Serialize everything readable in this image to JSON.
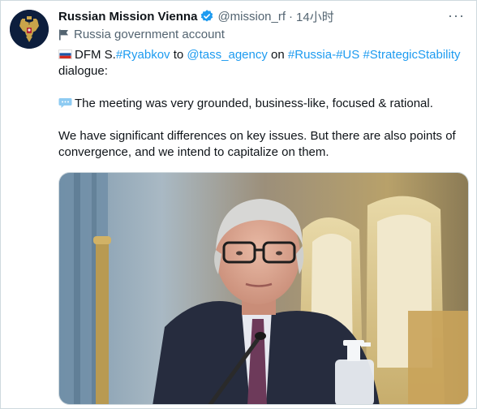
{
  "tweet": {
    "author_name": "Russian Mission Vienna",
    "handle": "@mission_rf",
    "separator": "·",
    "time": "14小时",
    "more_label": "···",
    "gov_label": "Russia government account",
    "icons": {
      "avatar": "russian-coat-of-arms",
      "verified": "verified-badge-icon",
      "gov": "flag-icon",
      "line1": "russia-flag-icon",
      "line2": "speech-bubble-icon"
    },
    "colors": {
      "link": "#1d9bf0",
      "secondary": "#536471",
      "verified": "#1d9bf0"
    },
    "text": {
      "line1_prefix": "DFM S.",
      "hashtag_ryabkov": "#Ryabkov",
      "word_to": " to ",
      "mention_tass": "@tass_agency",
      "word_on": " on ",
      "hashtag_russia": "#Russia",
      "dash": "-",
      "hashtag_us": "#US",
      "space": " ",
      "hashtag_strategic": "#StrategicStability",
      "line1_suffix": " dialogue:",
      "paragraph2": "The meeting was very grounded, business-like, focused & rational.",
      "paragraph3": "We have significant differences on key issues. But there are also points of convergence, and we intend to capitalize on them."
    }
  }
}
